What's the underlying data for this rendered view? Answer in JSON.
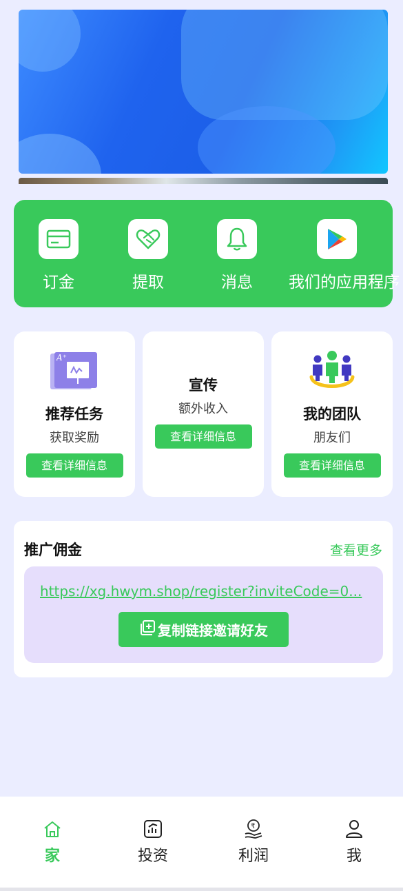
{
  "quick_actions": [
    {
      "label": "订金",
      "icon": "card-icon"
    },
    {
      "label": "提取",
      "icon": "heart-handshake-icon"
    },
    {
      "label": "消息",
      "icon": "bell-icon"
    },
    {
      "label": "我们的应用程序",
      "icon": "play-store-icon"
    }
  ],
  "cards": [
    {
      "title": "推荐任务",
      "subtitle": "获取奖励",
      "button": "查看详细信息",
      "icon": "presentation-board-icon"
    },
    {
      "title": "宣传",
      "subtitle": "额外收入",
      "button": "查看详细信息"
    },
    {
      "title": "我的团队",
      "subtitle": "朋友们",
      "button": "查看详细信息",
      "icon": "team-icon"
    }
  ],
  "promo": {
    "title": "推广佣金",
    "more": "查看更多",
    "link": "https://xg.hwym.shop/register?inviteCode=0...",
    "copy_button": "复制链接邀请好友"
  },
  "nav": [
    {
      "label": "家",
      "icon": "home-icon",
      "active": true
    },
    {
      "label": "投资",
      "icon": "chart-icon",
      "active": false
    },
    {
      "label": "利润",
      "icon": "rupee-hand-icon",
      "active": false
    },
    {
      "label": "我",
      "icon": "user-icon",
      "active": false
    }
  ],
  "colors": {
    "accent": "#39c95b",
    "background": "#ebedff",
    "promo_inner": "#e6defc"
  }
}
